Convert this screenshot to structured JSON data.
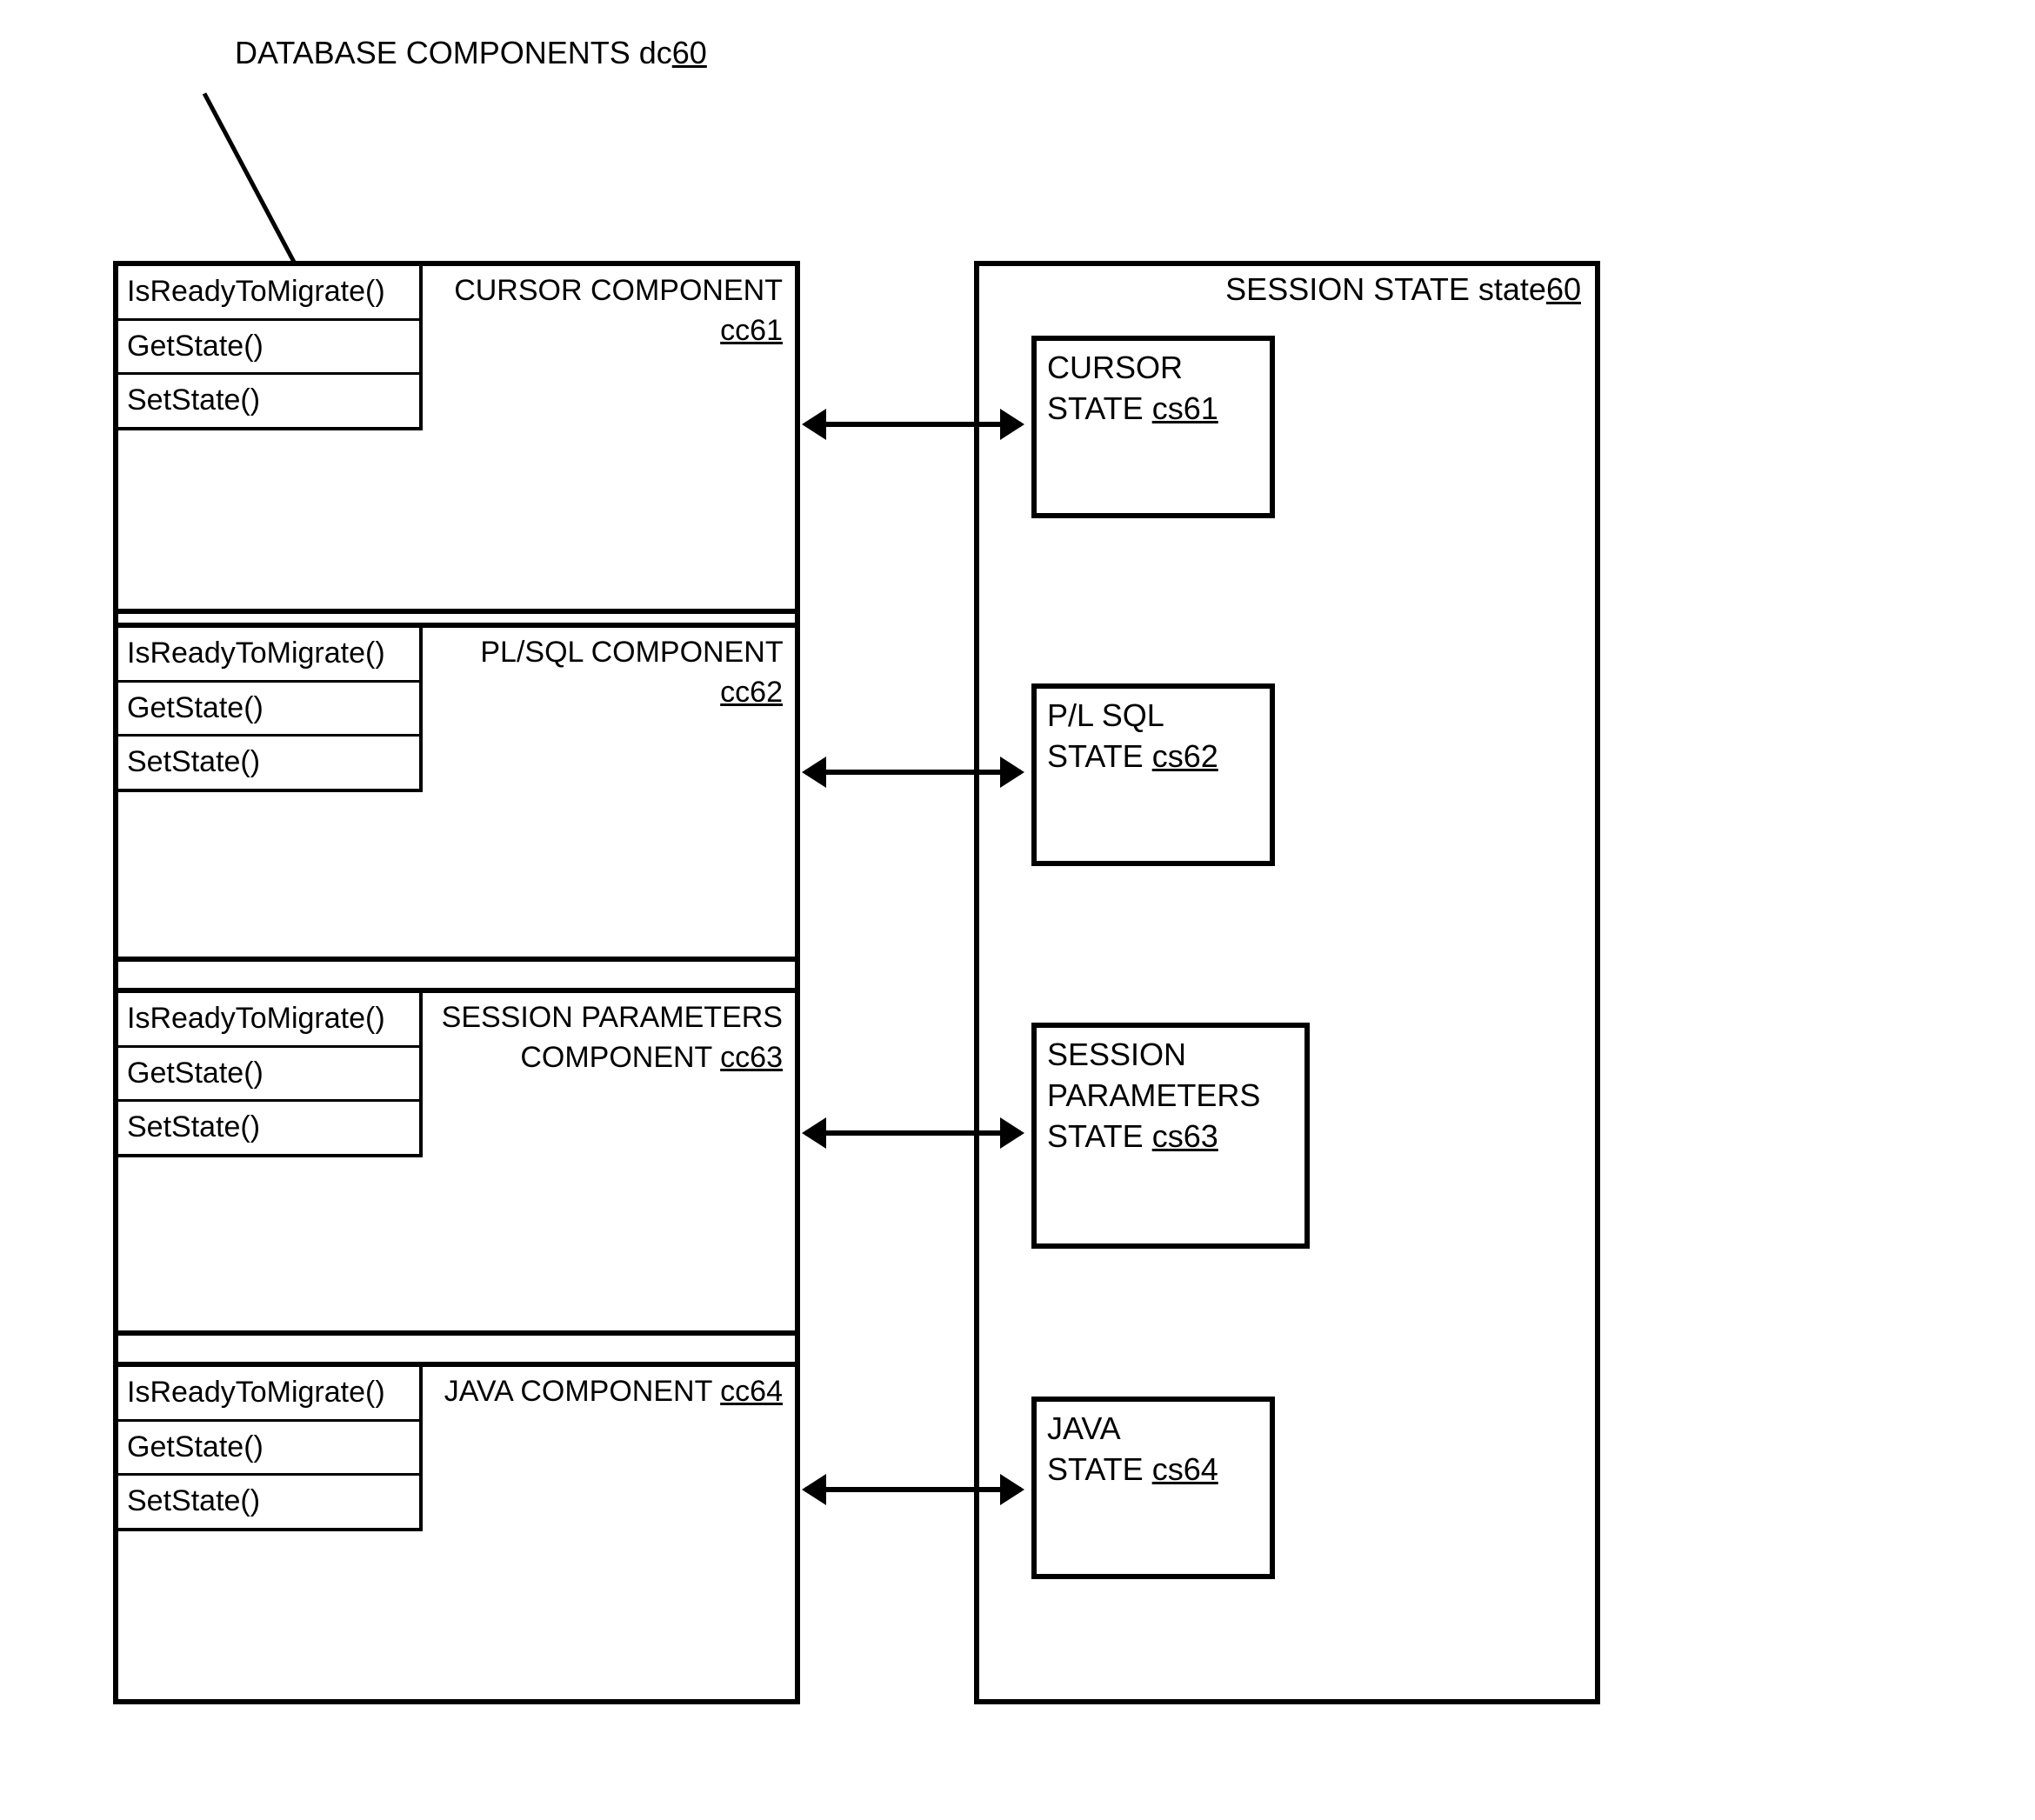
{
  "title": {
    "text": "DATABASE COMPONENTS dc",
    "ref": "60"
  },
  "leftBox": {
    "components": [
      {
        "labelPrefix": "CURSOR COMPONENT ",
        "refLabel": "cc61",
        "methods": [
          "IsReadyToMigrate()",
          "GetState()",
          "SetState()"
        ]
      },
      {
        "labelPrefix": "PL/SQL COMPONENT",
        "refLabel": "cc62",
        "methods": [
          "IsReadyToMigrate()",
          "GetState()",
          "SetState()"
        ]
      },
      {
        "labelLine1": "SESSION PARAMETERS",
        "labelLine2Prefix": "COMPONENT ",
        "refLabel": "cc63",
        "methods": [
          "IsReadyToMigrate()",
          "GetState()",
          "SetState()"
        ]
      },
      {
        "labelPrefix": "JAVA COMPONENT  ",
        "refLabel": "cc64",
        "methods": [
          "IsReadyToMigrate()",
          "GetState()",
          "SetState()"
        ]
      }
    ]
  },
  "rightBox": {
    "titlePrefix": "SESSION  STATE state",
    "titleRef": "60",
    "states": [
      {
        "line1": "CURSOR",
        "line2Prefix": "STATE ",
        "ref": "cs61"
      },
      {
        "line1": "P/L SQL",
        "line2Prefix": "STATE ",
        "ref": "cs62"
      },
      {
        "line1": "SESSION",
        "line2": "PARAMETERS",
        "line3Prefix": "STATE ",
        "ref": "cs63"
      },
      {
        "line1": "JAVA",
        "line2Prefix": "STATE ",
        "ref": "cs64"
      }
    ]
  }
}
